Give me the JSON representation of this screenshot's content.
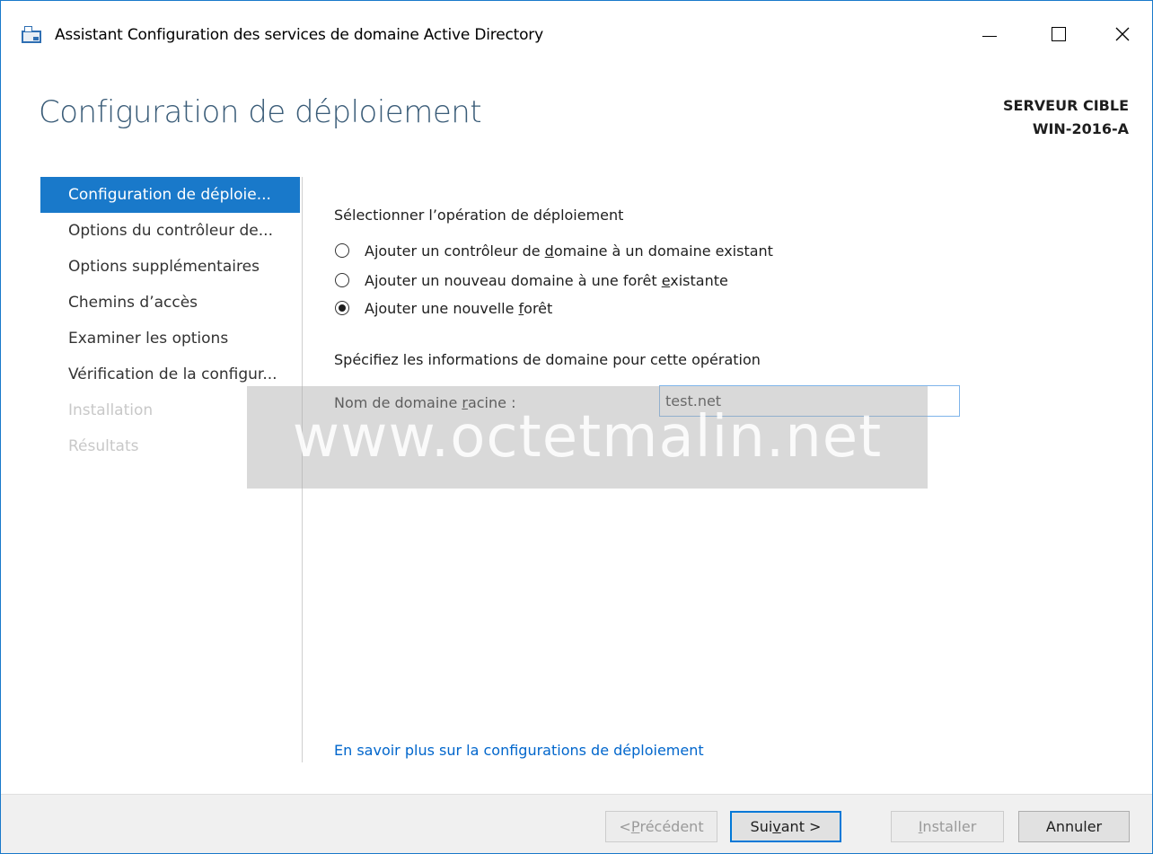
{
  "window": {
    "title": "Assistant Configuration des services de domaine Active Directory",
    "icon": "ad-wizard-icon"
  },
  "header": {
    "title": "Configuration de déploiement",
    "target_server_label": "SERVEUR CIBLE",
    "target_server_name": "WIN-2016-A"
  },
  "nav": {
    "items": [
      {
        "label": "Configuration de déploie...",
        "state": "active"
      },
      {
        "label": "Options du contrôleur de...",
        "state": "enabled"
      },
      {
        "label": "Options supplémentaires",
        "state": "enabled"
      },
      {
        "label": "Chemins d’accès",
        "state": "enabled"
      },
      {
        "label": "Examiner les options",
        "state": "enabled"
      },
      {
        "label": "Vérification de la configur...",
        "state": "enabled"
      },
      {
        "label": "Installation",
        "state": "disabled"
      },
      {
        "label": "Résultats",
        "state": "disabled"
      }
    ]
  },
  "main": {
    "operation_heading": "Sélectionner l’opération de déploiement",
    "options": [
      {
        "label_pre": "Ajouter un contrôleur de ",
        "label_key": "d",
        "label_post": "omaine à un domaine existant",
        "checked": false
      },
      {
        "label_pre": "Ajouter un nouveau domaine à une forêt ",
        "label_key": "e",
        "label_post": "xistante",
        "checked": false
      },
      {
        "label_pre": "Ajouter une nouvelle ",
        "label_key": "f",
        "label_post": "orêt",
        "checked": true
      }
    ],
    "domain_info_heading": "Spécifiez les informations de domaine pour cette opération",
    "domain_label_pre": "Nom de domaine ",
    "domain_label_key": "r",
    "domain_label_post": "acine :",
    "domain_value": "test.net",
    "learn_more_link": "En savoir plus sur la configurations de déploiement"
  },
  "watermark": "www.octetmalin.net",
  "footer": {
    "prev": {
      "pre": "< ",
      "key": "P",
      "post": "récédent",
      "enabled": false
    },
    "next": {
      "pre": "Sui",
      "key": "v",
      "post": "ant >",
      "enabled": true
    },
    "install": {
      "pre": "",
      "key": "I",
      "post": "nstaller",
      "enabled": false
    },
    "cancel": {
      "label": "Annuler",
      "enabled": true
    }
  },
  "colors": {
    "accent": "#1979ca",
    "link": "#0066cc",
    "title": "#3a5c78"
  }
}
